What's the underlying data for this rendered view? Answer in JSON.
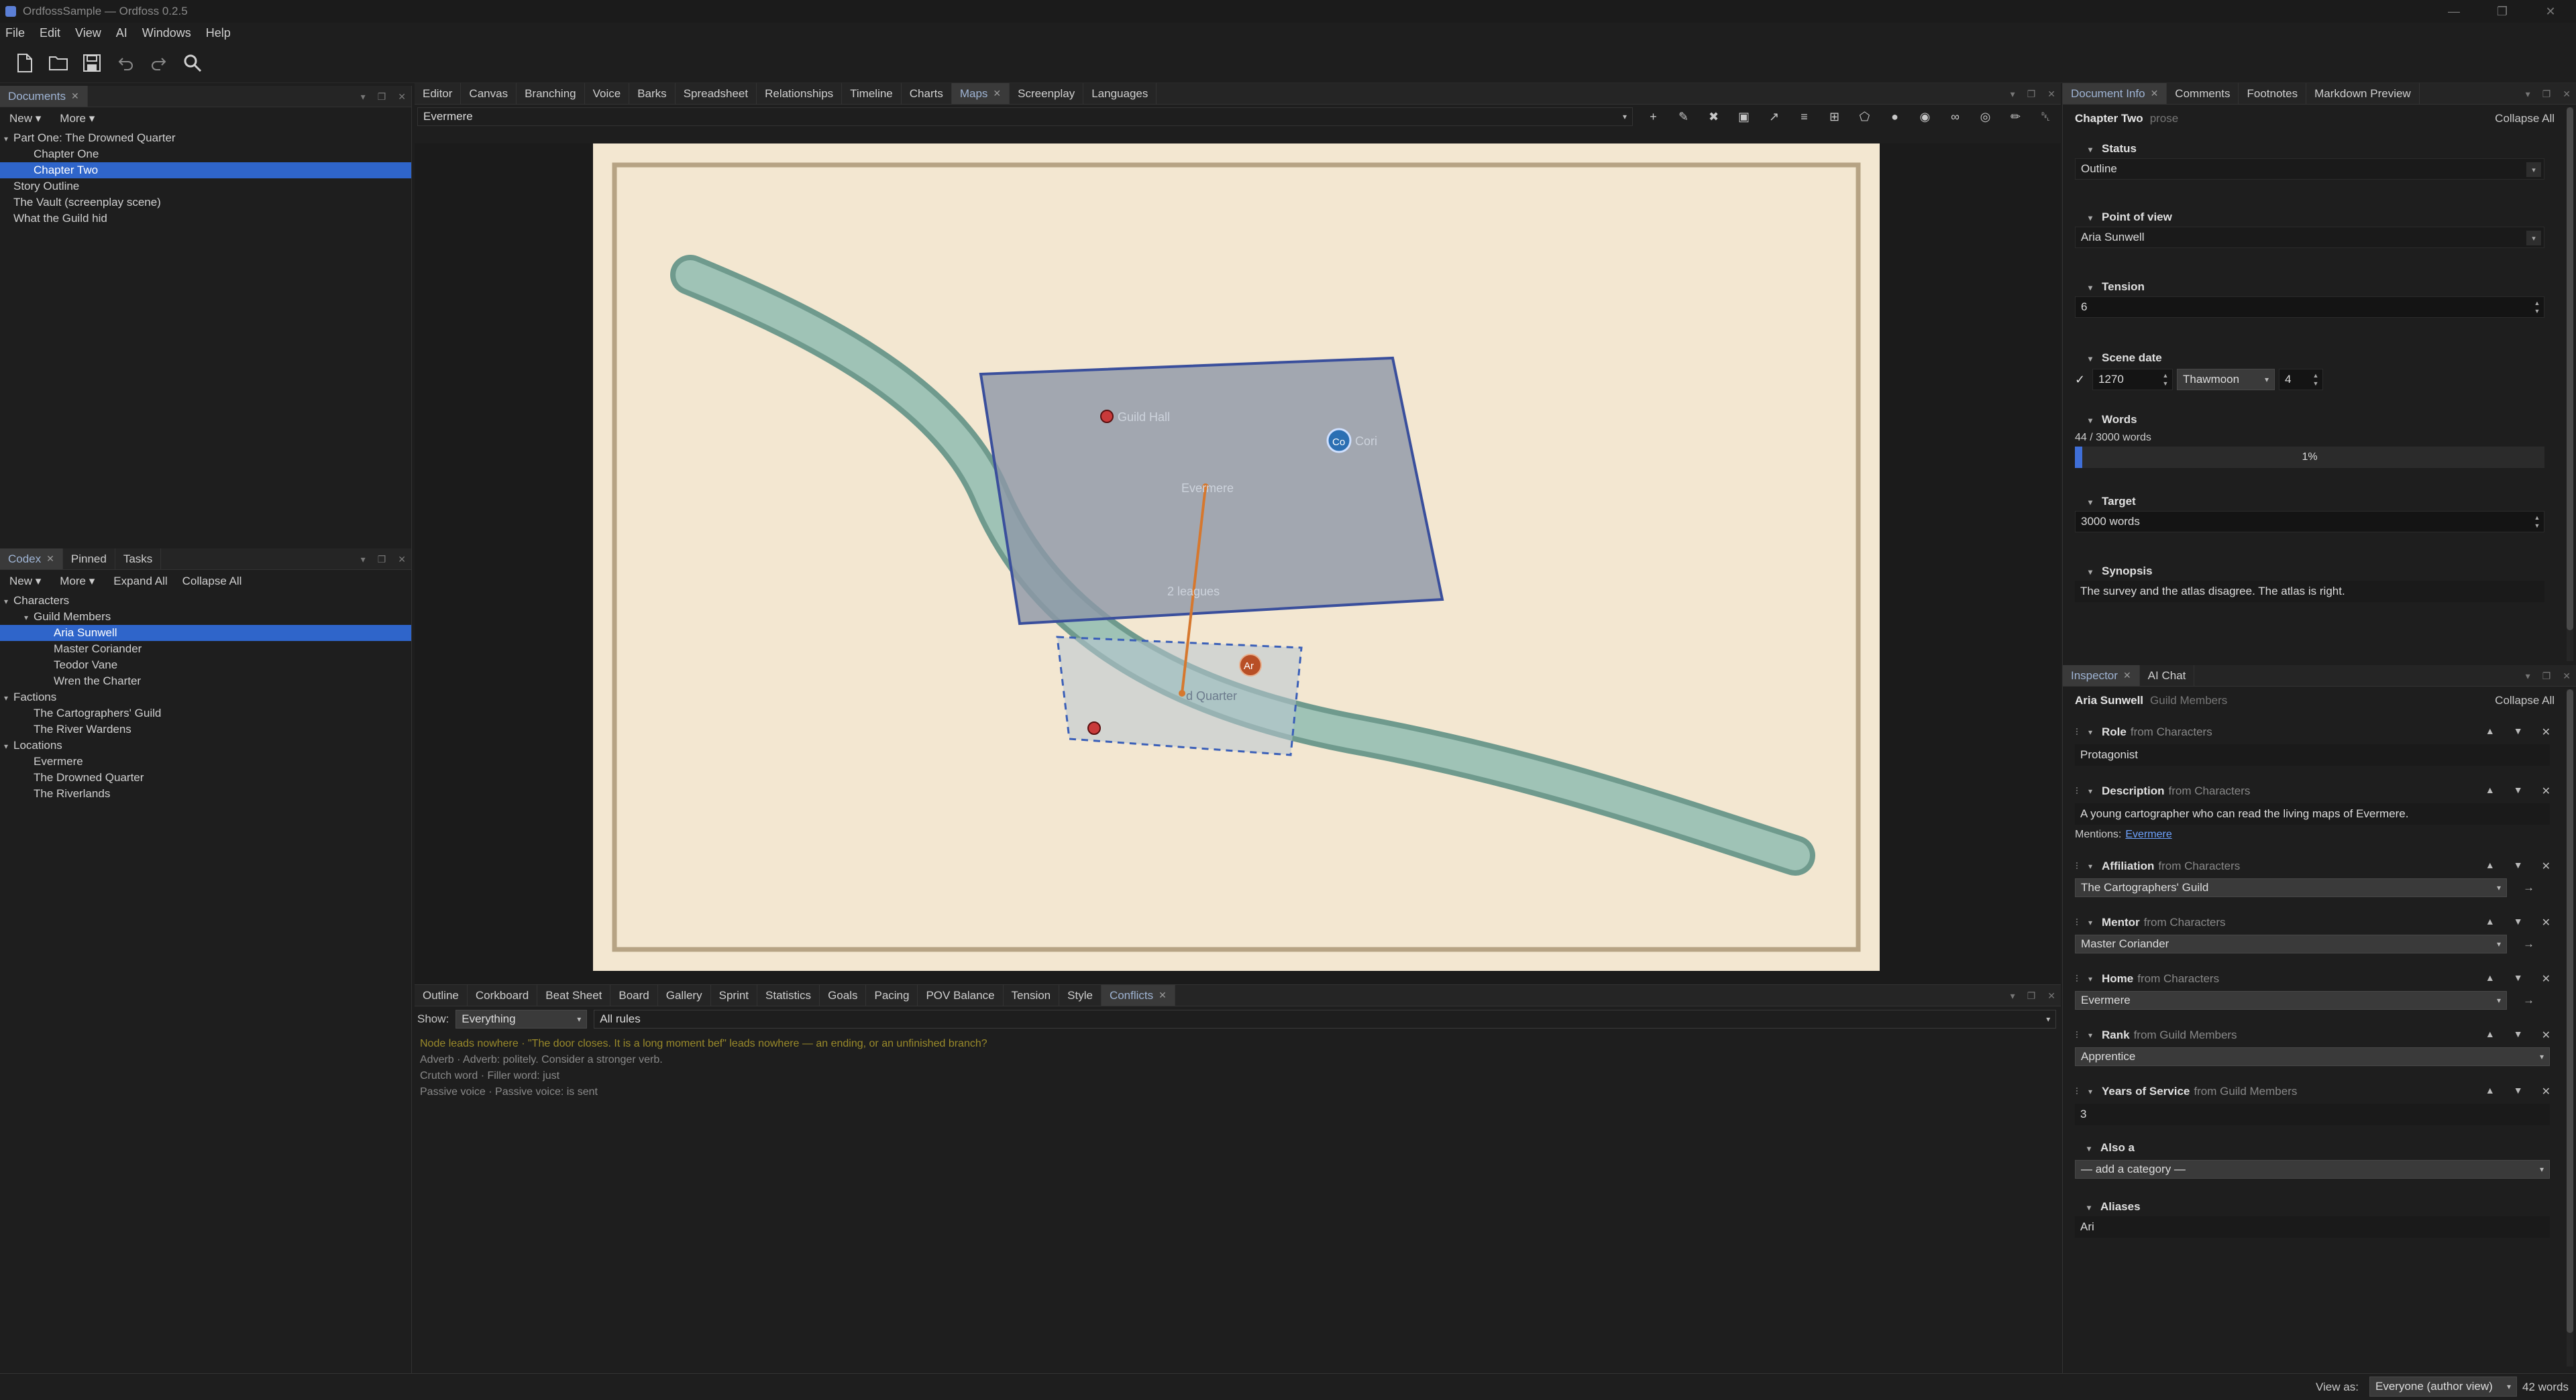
{
  "window": {
    "title": "OrdfossSample — Ordfoss 0.2.5"
  },
  "menu": [
    "File",
    "Edit",
    "View",
    "AI",
    "Windows",
    "Help"
  ],
  "toolbar_icons": [
    "new-document-icon",
    "open-folder-icon",
    "save-icon",
    "undo-icon",
    "redo-icon",
    "search-icon"
  ],
  "documents": {
    "tab": "Documents",
    "new_label": "New",
    "more_label": "More",
    "tree": [
      {
        "label": "Part One: The Drowned Quarter",
        "level": 0,
        "expander": "down"
      },
      {
        "label": "Chapter One",
        "level": 1
      },
      {
        "label": "Chapter Two",
        "level": 1,
        "selected": true
      },
      {
        "label": "Story Outline",
        "level": 0
      },
      {
        "label": "The Vault (screenplay scene)",
        "level": 0
      },
      {
        "label": "What the Guild hid",
        "level": 0
      }
    ]
  },
  "codex": {
    "tabs": [
      "Codex",
      "Pinned",
      "Tasks"
    ],
    "new_label": "New",
    "more_label": "More",
    "expand_all": "Expand All",
    "collapse_all": "Collapse All",
    "tree": [
      {
        "label": "Characters",
        "level": 0,
        "expander": "down"
      },
      {
        "label": "Guild Members",
        "level": 1,
        "expander": "down"
      },
      {
        "label": "Aria Sunwell",
        "level": 2,
        "selected": true
      },
      {
        "label": "Master Coriander",
        "level": 2
      },
      {
        "label": "Teodor Vane",
        "level": 2
      },
      {
        "label": "Wren the Charter",
        "level": 2
      },
      {
        "label": "Factions",
        "level": 0,
        "expander": "down"
      },
      {
        "label": "The Cartographers' Guild",
        "level": 1
      },
      {
        "label": "The River Wardens",
        "level": 1
      },
      {
        "label": "Locations",
        "level": 0,
        "expander": "down"
      },
      {
        "label": "Evermere",
        "level": 1
      },
      {
        "label": "The Drowned Quarter",
        "level": 1
      },
      {
        "label": "The Riverlands",
        "level": 1
      }
    ]
  },
  "center": {
    "tabs": [
      "Editor",
      "Canvas",
      "Branching",
      "Voice",
      "Barks",
      "Spreadsheet",
      "Relationships",
      "Timeline",
      "Charts",
      "Maps",
      "Screenplay",
      "Languages"
    ],
    "active_tab": "Maps",
    "map_selector": "Evermere",
    "map_tool_icons": [
      "add-icon",
      "pen-icon",
      "delete-icon",
      "image-icon",
      "measure-icon",
      "layers-icon",
      "grid-icon",
      "polygon-icon",
      "pin-icon",
      "target-icon",
      "link-icon",
      "eye-icon",
      "brush-icon",
      "trash-icon"
    ],
    "map": {
      "labels": {
        "guild_hall": "Guild Hall",
        "evermere": "Evermere",
        "distance": "2 leagues",
        "quarter": "d Quarter",
        "cori_badge": "Co",
        "cori_label": "Cori",
        "aria_badge": "Ar"
      },
      "colors": {
        "parchment": "#f3e7d1",
        "border": "#b6a384",
        "river": "#87b3a6",
        "region": "#8d97a7",
        "region_edge": "#3a4f9c",
        "measure": "#d6782e",
        "pin": "#c93a3a",
        "cori": "#2b6fb3",
        "aria": "#b84f26"
      }
    }
  },
  "bottom": {
    "tabs": [
      "Outline",
      "Corkboard",
      "Beat Sheet",
      "Board",
      "Gallery",
      "Sprint",
      "Statistics",
      "Goals",
      "Pacing",
      "POV Balance",
      "Tension",
      "Style",
      "Conflicts"
    ],
    "active_tab": "Conflicts",
    "show_label": "Show:",
    "show_value": "Everything",
    "rules_value": "All rules",
    "conflicts": [
      {
        "text": "Node leads nowhere  ·  \"The door closes. It is a long moment bef\" leads nowhere — an ending, or an unfinished branch?",
        "color": "#9a8a2a"
      },
      {
        "text": "Adverb  ·  Adverb: politely. Consider a stronger verb.",
        "color": "#8a8a8a"
      },
      {
        "text": "Crutch word  ·  Filler word: just",
        "color": "#8a8a8a"
      },
      {
        "text": "Passive voice  ·  Passive voice: is sent",
        "color": "#8a8a8a"
      }
    ]
  },
  "docinfo": {
    "tabs": [
      "Document Info",
      "Comments",
      "Footnotes",
      "Markdown Preview"
    ],
    "title": "Chapter Two",
    "type": "prose",
    "collapse_all": "Collapse All",
    "status_label": "Status",
    "status_value": "Outline",
    "pov_label": "Point of view",
    "pov_value": "Aria Sunwell",
    "tension_label": "Tension",
    "tension_value": "6",
    "scene_date_label": "Scene date",
    "scene_year": "1270",
    "scene_month": "Thawmoon",
    "scene_day": "4",
    "words_label": "Words",
    "words_value": "44 / 3000 words",
    "words_percent_label": "1%",
    "words_progress": 0.015,
    "target_label": "Target",
    "target_value": "3000 words",
    "synopsis_label": "Synopsis",
    "synopsis_value": "The survey and the atlas disagree. The atlas is right."
  },
  "inspector": {
    "tabs": [
      "Inspector",
      "AI Chat"
    ],
    "name": "Aria Sunwell",
    "category": "Guild Members",
    "collapse_all": "Collapse All",
    "fields": {
      "role": {
        "label": "Role",
        "from": "from Characters",
        "value": "Protagonist"
      },
      "description": {
        "label": "Description",
        "from": "from Characters",
        "value": "A young cartographer who can read the living maps of Evermere.",
        "mentions": "Mentions:",
        "mention_link": "Evermere"
      },
      "affiliation": {
        "label": "Affiliation",
        "from": "from Characters",
        "value": "The Cartographers' Guild"
      },
      "mentor": {
        "label": "Mentor",
        "from": "from Characters",
        "value": "Master Coriander"
      },
      "home": {
        "label": "Home",
        "from": "from Characters",
        "value": "Evermere"
      },
      "rank": {
        "label": "Rank",
        "from": "from Guild Members",
        "value": "Apprentice"
      },
      "years": {
        "label": "Years of Service",
        "from": "from Guild Members",
        "value": "3"
      }
    },
    "also_label": "Also a",
    "also_value": "— add a category —",
    "aliases_label": "Aliases",
    "aliases_value": "Ari"
  },
  "status": {
    "view_as_label": "View as:",
    "view_as_value": "Everyone (author view)",
    "word_count": "42 words"
  }
}
